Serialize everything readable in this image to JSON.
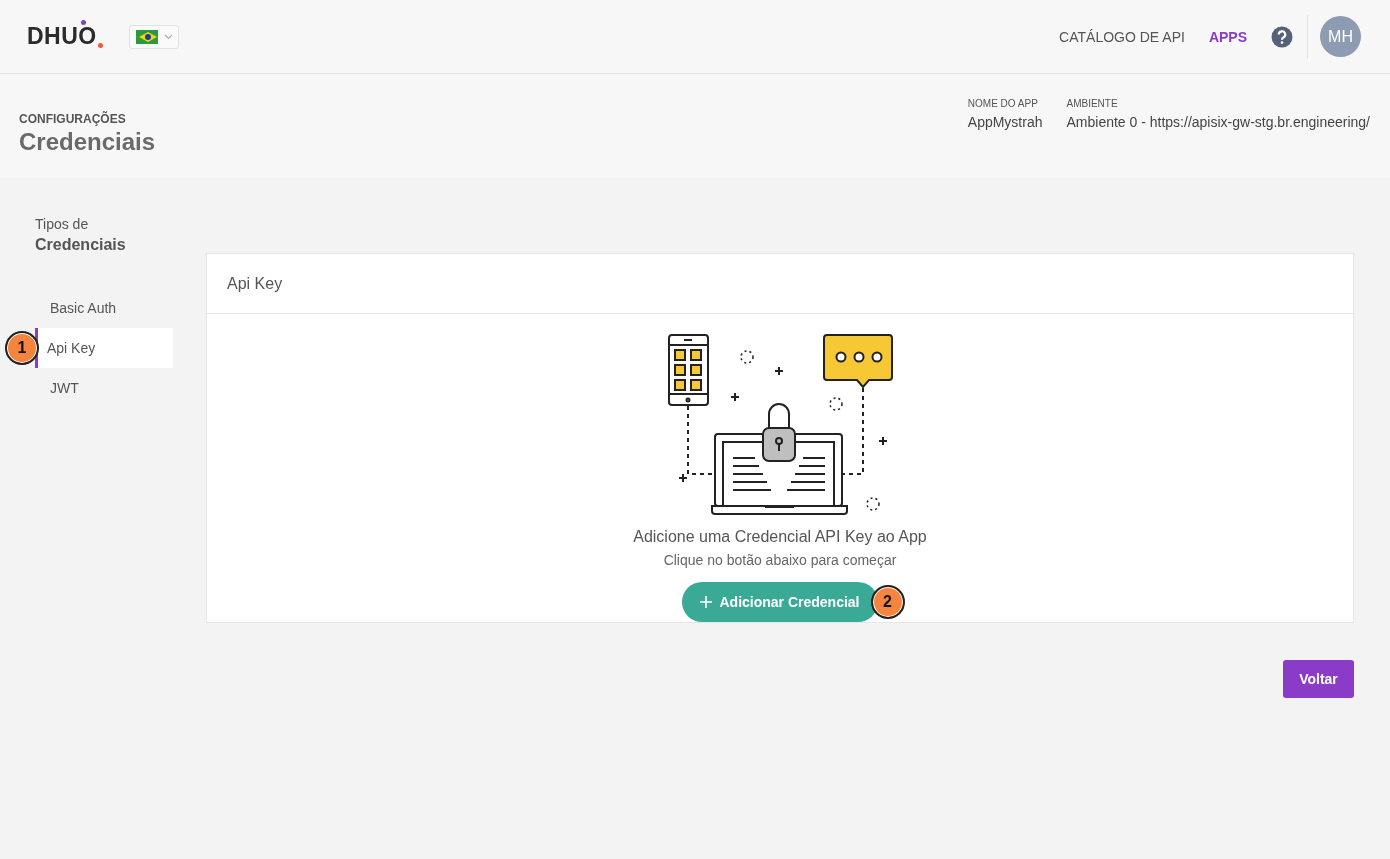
{
  "header": {
    "logo": "DHUO",
    "nav": [
      {
        "label": "CATÁLOGO DE API",
        "selected": false
      },
      {
        "label": "APPS",
        "selected": true
      }
    ],
    "avatar": "MH"
  },
  "page": {
    "section": "CONFIGURAÇÕES",
    "title": "Credenciais",
    "meta": [
      {
        "label": "NOME DO APP",
        "value": "AppMystrah"
      },
      {
        "label": "AMBIENTE",
        "value": "Ambiente 0 - https://apisix-gw-stg.br.engineering/"
      }
    ]
  },
  "sidebar": {
    "subtitle": "Tipos de",
    "title": "Credenciais",
    "items": [
      {
        "label": "Basic Auth",
        "selected": false
      },
      {
        "label": "Api Key",
        "selected": true,
        "callout": "1"
      },
      {
        "label": "JWT",
        "selected": false
      }
    ]
  },
  "card": {
    "title": "Api Key",
    "empty_title": "Adicione uma Credencial API Key ao App",
    "empty_hint": "Clique no botão abaixo para começar",
    "button": "Adicionar Credencial",
    "button_callout": "2"
  },
  "footer": {
    "button": "Voltar"
  }
}
